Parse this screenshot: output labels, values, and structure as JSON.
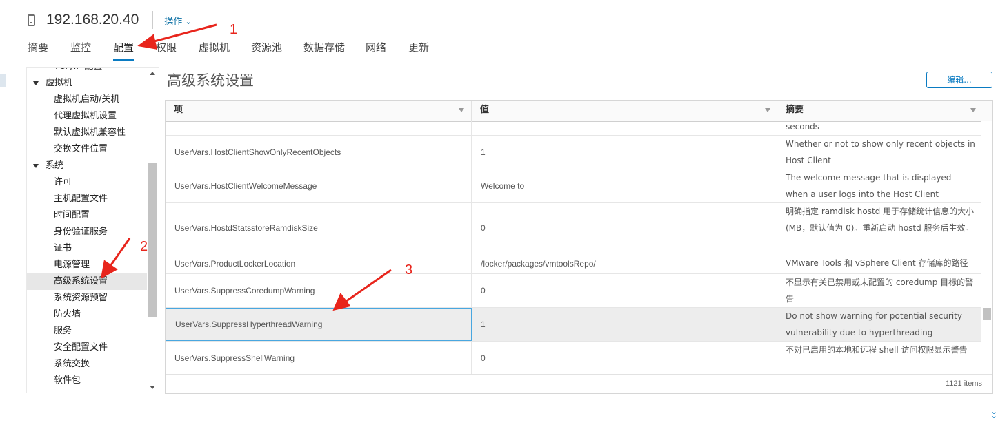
{
  "header": {
    "host_title": "192.168.20.40",
    "actions_label": "操作",
    "actions_chevron": "⌄"
  },
  "tabs": [
    {
      "label": "摘要",
      "active": false
    },
    {
      "label": "监控",
      "active": false
    },
    {
      "label": "配置",
      "active": true
    },
    {
      "label": "权限",
      "active": false
    },
    {
      "label": "虚拟机",
      "active": false
    },
    {
      "label": "资源池",
      "active": false
    },
    {
      "label": "数据存储",
      "active": false
    },
    {
      "label": "网络",
      "active": false
    },
    {
      "label": "更新",
      "active": false
    }
  ],
  "tree": {
    "partial_top": "TCP/IP 配置",
    "groups": [
      {
        "label": "虚拟机",
        "items": [
          "虚拟机启动/关机",
          "代理虚拟机设置",
          "默认虚拟机兼容性",
          "交换文件位置"
        ]
      },
      {
        "label": "系统",
        "items": [
          "许可",
          "主机配置文件",
          "时间配置",
          "身份验证服务",
          "证书",
          "电源管理",
          "高级系统设置",
          "系统资源预留",
          "防火墙",
          "服务",
          "安全配置文件",
          "系统交换",
          "软件包"
        ]
      }
    ],
    "selected": "高级系统设置"
  },
  "panel": {
    "title": "高级系统设置",
    "edit_label": "编辑..."
  },
  "grid": {
    "columns": [
      "项",
      "值",
      "摘要"
    ],
    "rows": [
      {
        "key": "",
        "value": "",
        "summary": "seconds"
      },
      {
        "key": "UserVars.HostClientShowOnlyRecentObjects",
        "value": "1",
        "summary": "Whether or not to show only recent objects in Host Client"
      },
      {
        "key": "UserVars.HostClientWelcomeMessage",
        "value": "Welcome to",
        "summary": "The welcome message that is displayed when a user logs into the Host Client"
      },
      {
        "key": "UserVars.HostdStatsstoreRamdiskSize",
        "value": "0",
        "summary": "明确指定 ramdisk hostd 用于存储统计信息的大小 (MB，默认值为 0)。重新启动 hostd 服务后生效。"
      },
      {
        "key": "UserVars.ProductLockerLocation",
        "value": "/locker/packages/vmtoolsRepo/",
        "summary": "VMware Tools 和 vSphere Client 存储库的路径"
      },
      {
        "key": "UserVars.SuppressCoredumpWarning",
        "value": "0",
        "summary": "不显示有关已禁用或未配置的 coredump 目标的警告"
      },
      {
        "key": "UserVars.SuppressHyperthreadWarning",
        "value": "1",
        "summary": "Do not show warning for potential security vulnerability due to hyperthreading",
        "selected": true
      },
      {
        "key": "UserVars.SuppressShellWarning",
        "value": "0",
        "summary": "不对已启用的本地和远程 shell 访问权限显示警告"
      }
    ],
    "footer_count": "1121 items"
  },
  "annotations": [
    "1",
    "2",
    "3"
  ],
  "colors": {
    "accent": "#0a7bc2",
    "annotation": "#e8251c",
    "selected_row": "#ededed"
  }
}
